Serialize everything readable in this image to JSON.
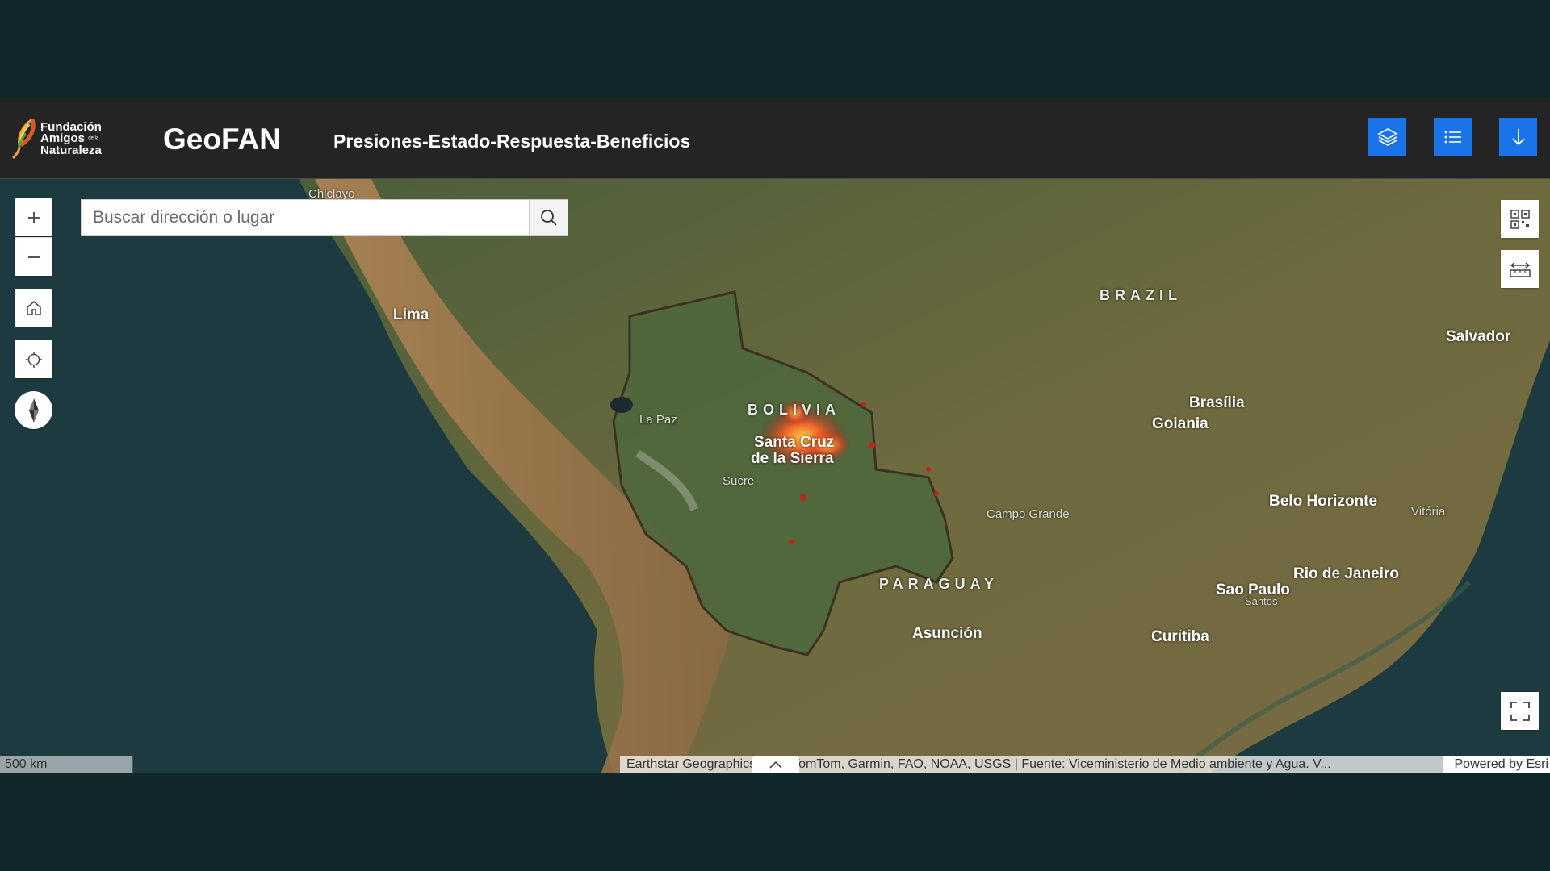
{
  "header": {
    "logo": {
      "line1": "Fundación",
      "line2": "Amigos",
      "line2_small": "de la",
      "line3": "Naturaleza"
    },
    "title": "GeoFAN",
    "subtitle": "Presiones-Estado-Respuesta-Beneficios",
    "buttons": [
      {
        "id": "layers",
        "icon": "layers-icon"
      },
      {
        "id": "legend",
        "icon": "list-icon"
      },
      {
        "id": "download",
        "icon": "arrow-down-icon"
      }
    ],
    "button_color": "#1a73e8"
  },
  "search": {
    "placeholder": "Buscar dirección o lugar"
  },
  "map": {
    "labels": {
      "chiclayo": "Chiclayo",
      "lima": "Lima",
      "brazil": "BRAZIL",
      "salvador": "Salvador",
      "bolivia": "BOLIVIA",
      "la_paz": "La Paz",
      "santa_cruz": "Santa Cruz",
      "de_la_sierra": "de la Sierra",
      "sucre": "Sucre",
      "brasilia": "Brasília",
      "goiania": "Goiania",
      "campo_grande": "Campo Grande",
      "belo_horizonte": "Belo Horizonte",
      "vitoria": "Vitória",
      "paraguay": "PARAGUAY",
      "rio": "Rio de Janeiro",
      "sao_paulo": "Sao Paulo",
      "santos": "Santos",
      "asuncion": "Asunción",
      "curitiba": "Curitiba"
    },
    "scale_label": "500 km",
    "attribution": "Earthstar Geographics, Esri, TomTom, Garmin, FAO, NOAA, USGS | Fuente: Viceministerio de Medio ambiente y Agua. V...",
    "powered_by": "Powered by Esri"
  }
}
